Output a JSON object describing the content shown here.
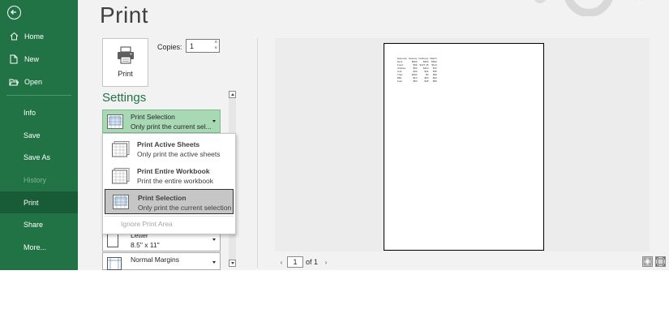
{
  "sidebar": {
    "items": [
      {
        "label": "Home"
      },
      {
        "label": "New"
      },
      {
        "label": "Open"
      },
      {
        "label": "Info"
      },
      {
        "label": "Save"
      },
      {
        "label": "Save As"
      },
      {
        "label": "History"
      },
      {
        "label": "Print"
      },
      {
        "label": "Share"
      },
      {
        "label": "More..."
      }
    ]
  },
  "main": {
    "title": "Print",
    "print_button": "Print",
    "copies_label": "Copies:",
    "copies_value": "1",
    "settings_heading": "Settings",
    "print_what": {
      "title": "Print Selection",
      "subtitle": "Only print the current sel..."
    },
    "dropdown": {
      "items": [
        {
          "title": "Print Active Sheets",
          "subtitle": "Only print the active sheets"
        },
        {
          "title": "Print Entire Workbook",
          "subtitle": "Print the entire workbook"
        },
        {
          "title": "Print Selection",
          "subtitle": "Only print the current selection"
        }
      ],
      "disabled_option": "Ignore Print Area"
    },
    "paper": {
      "title": "Letter",
      "subtitle": "8.5\" x 11\""
    },
    "margins": {
      "title": "Normal Margins"
    }
  },
  "preview": {
    "current_page": "1",
    "of_label": "of 1",
    "sheet": {
      "headers": [
        "Expense",
        "January",
        "February",
        "March"
      ],
      "rows": [
        [
          "Rent",
          "$900",
          "$900",
          "$900"
        ],
        [
          "Food",
          "$99",
          "$127.45",
          "$114"
        ],
        [
          "Clothes",
          "$50",
          "$110",
          "$72"
        ],
        [
          "Cell",
          "$30",
          "$34",
          "$35"
        ],
        [
          "Trips",
          "$300",
          "$0",
          "$50"
        ],
        [
          "Bills",
          "$10",
          "$30",
          "$22"
        ],
        [
          "Fuel",
          "$50",
          "$48",
          "$50"
        ]
      ]
    }
  },
  "colors": {
    "sidebar": "#217346",
    "sidebar_active": "#185c37",
    "accent_green": "#217346",
    "selected_option": "#a9d8b5"
  }
}
